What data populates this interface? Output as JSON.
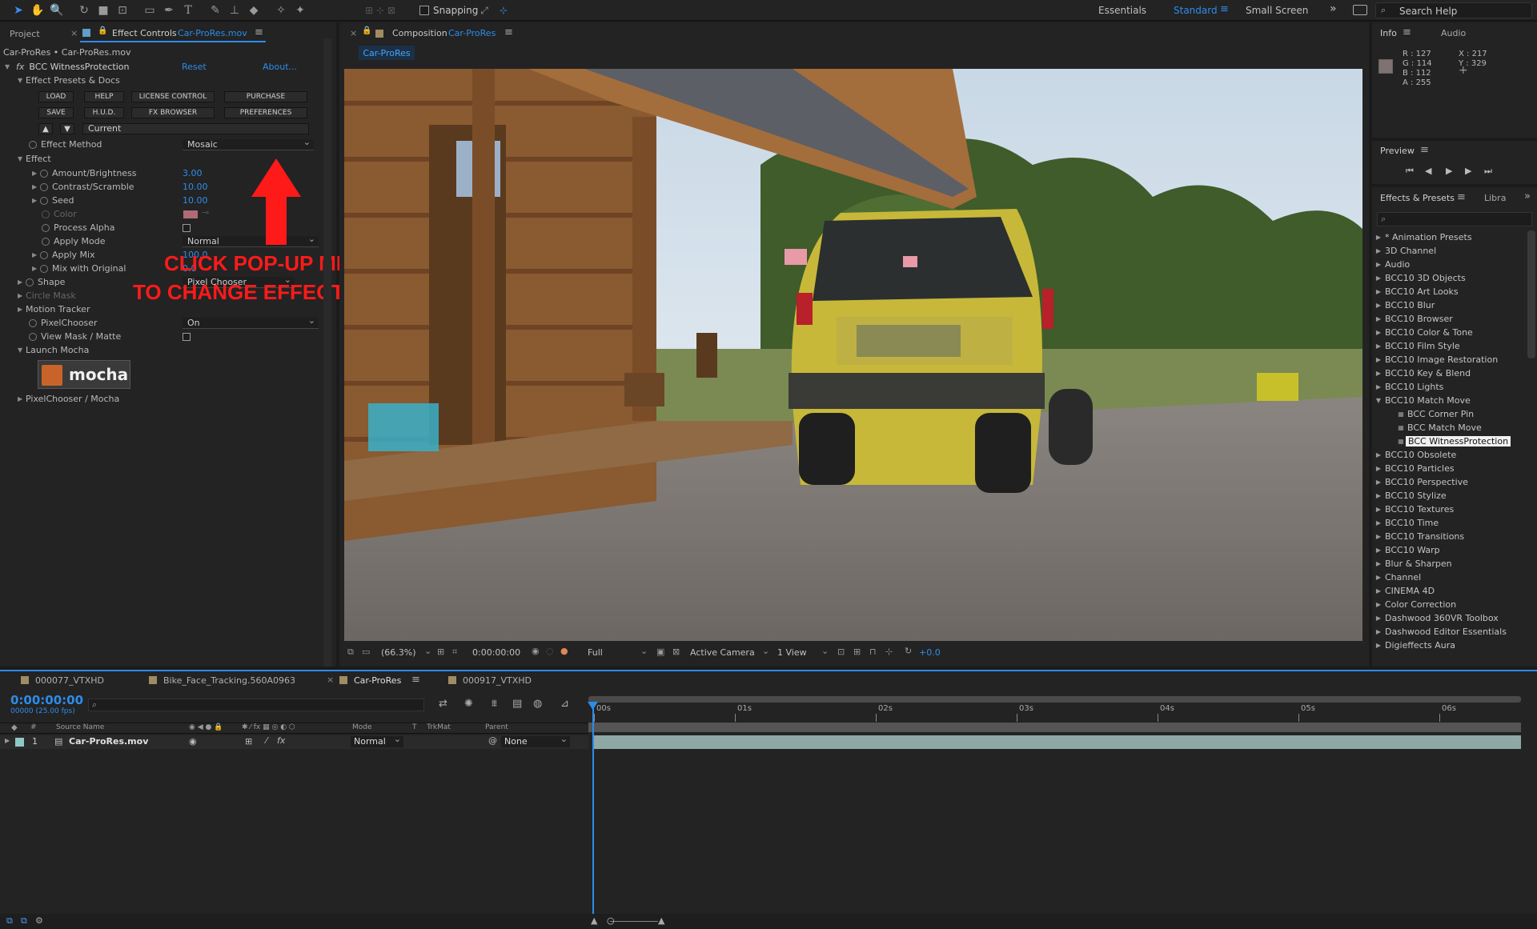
{
  "topbar": {
    "workspaces": [
      "Essentials",
      "Standard",
      "Small Screen"
    ],
    "active_workspace": "Standard",
    "snapping_label": "Snapping",
    "search_placeholder": "Search Help"
  },
  "left_panel": {
    "tabs": [
      "Project",
      "Effect Controls",
      "Car-ProRes.mov"
    ],
    "subtitle": "Car-ProRes • Car-ProRes.mov",
    "effect_name": "BCC WitnessProtection",
    "reset": "Reset",
    "about": "About...",
    "presets_section": "Effect Presets & Docs",
    "buttons_row1": [
      "LOAD",
      "HELP",
      "LICENSE CONTROL",
      "PURCHASE"
    ],
    "buttons_row2": [
      "SAVE",
      "H.U.D.",
      "FX BROWSER",
      "PREFERENCES"
    ],
    "preset_current": "Current",
    "effect_method_label": "Effect Method",
    "effect_method_value": "Mosaic",
    "effect_section": "Effect",
    "params": {
      "amount_label": "Amount/Brightness",
      "amount_value": "3.00",
      "contrast_label": "Contrast/Scramble",
      "contrast_value": "10.00",
      "seed_label": "Seed",
      "seed_value": "10.00",
      "color_label": "Color",
      "process_alpha_label": "Process Alpha",
      "apply_mode_label": "Apply Mode",
      "apply_mode_value": "Normal",
      "apply_mix_label": "Apply Mix",
      "apply_mix_value": "100.0",
      "mix_original_label": "Mix with Original",
      "mix_original_value": "0.0",
      "shape_label": "Shape",
      "shape_value": "Pixel Chooser"
    },
    "circle_mask": "Circle Mask",
    "motion_tracker": "Motion Tracker",
    "pixelchooser_label": "PixelChooser",
    "pixelchooser_value": "On",
    "view_mask_label": "View Mask / Matte",
    "launch_mocha": "Launch Mocha",
    "mocha_logo": "mocha",
    "pixelchooser_mocha": "PixelChooser / Mocha",
    "annotation_line1": "CLICK POP-UP MENU",
    "annotation_line2": "TO CHANGE EFFECT TYPE",
    "annotation_color": "#ff1a1a"
  },
  "composition": {
    "tab_prefix": "Composition",
    "tab_name": "Car-ProRes",
    "sub_tab": "Car-ProRes",
    "zoom": "(66.3%)",
    "timecode": "0:00:00:00",
    "resolution": "Full",
    "camera": "Active Camera",
    "views": "1 View",
    "exposure": "+0.0"
  },
  "info": {
    "tabs": [
      "Info",
      "Audio"
    ],
    "r": "R : 127",
    "g": "G : 114",
    "b": "B : 112",
    "a": "A : 255",
    "x": "X : 217",
    "y": "Y : 329",
    "swatch_color": "#7f7270"
  },
  "preview": {
    "title": "Preview"
  },
  "effects_presets": {
    "tabs": [
      "Effects & Presets",
      "Libra"
    ],
    "items": [
      "* Animation Presets",
      "3D Channel",
      "Audio",
      "BCC10 3D Objects",
      "BCC10 Art Looks",
      "BCC10 Blur",
      "BCC10 Browser",
      "BCC10 Color & Tone",
      "BCC10 Film Style",
      "BCC10 Image Restoration",
      "BCC10 Key & Blend",
      "BCC10 Lights",
      "BCC10 Match Move"
    ],
    "children": [
      "BCC Corner Pin",
      "BCC Match Move",
      "BCC WitnessProtection"
    ],
    "items_after": [
      "BCC10 Obsolete",
      "BCC10 Particles",
      "BCC10 Perspective",
      "BCC10 Stylize",
      "BCC10 Textures",
      "BCC10 Time",
      "BCC10 Transitions",
      "BCC10 Warp",
      "Blur & Sharpen",
      "Channel",
      "CINEMA 4D",
      "Color Correction",
      "Dashwood 360VR Toolbox",
      "Dashwood Editor Essentials",
      "Digieffects Aura"
    ]
  },
  "timeline": {
    "tabs": [
      "000077_VTXHD",
      "Bike_Face_Tracking.560A0963",
      "Car-ProRes",
      "000917_VTXHD"
    ],
    "timecode": "0:00:00:00",
    "frame_info": "00000 (25.00 fps)",
    "columns": {
      "num": "#",
      "source": "Source Name",
      "mode": "Mode",
      "t": "T",
      "trkmat": "TrkMat",
      "parent": "Parent"
    },
    "ruler": [
      "00s",
      "01s",
      "02s",
      "03s",
      "04s",
      "05s",
      "06s"
    ],
    "layer": {
      "num": "1",
      "name": "Car-ProRes.mov",
      "mode": "Normal",
      "parent": "None"
    }
  }
}
